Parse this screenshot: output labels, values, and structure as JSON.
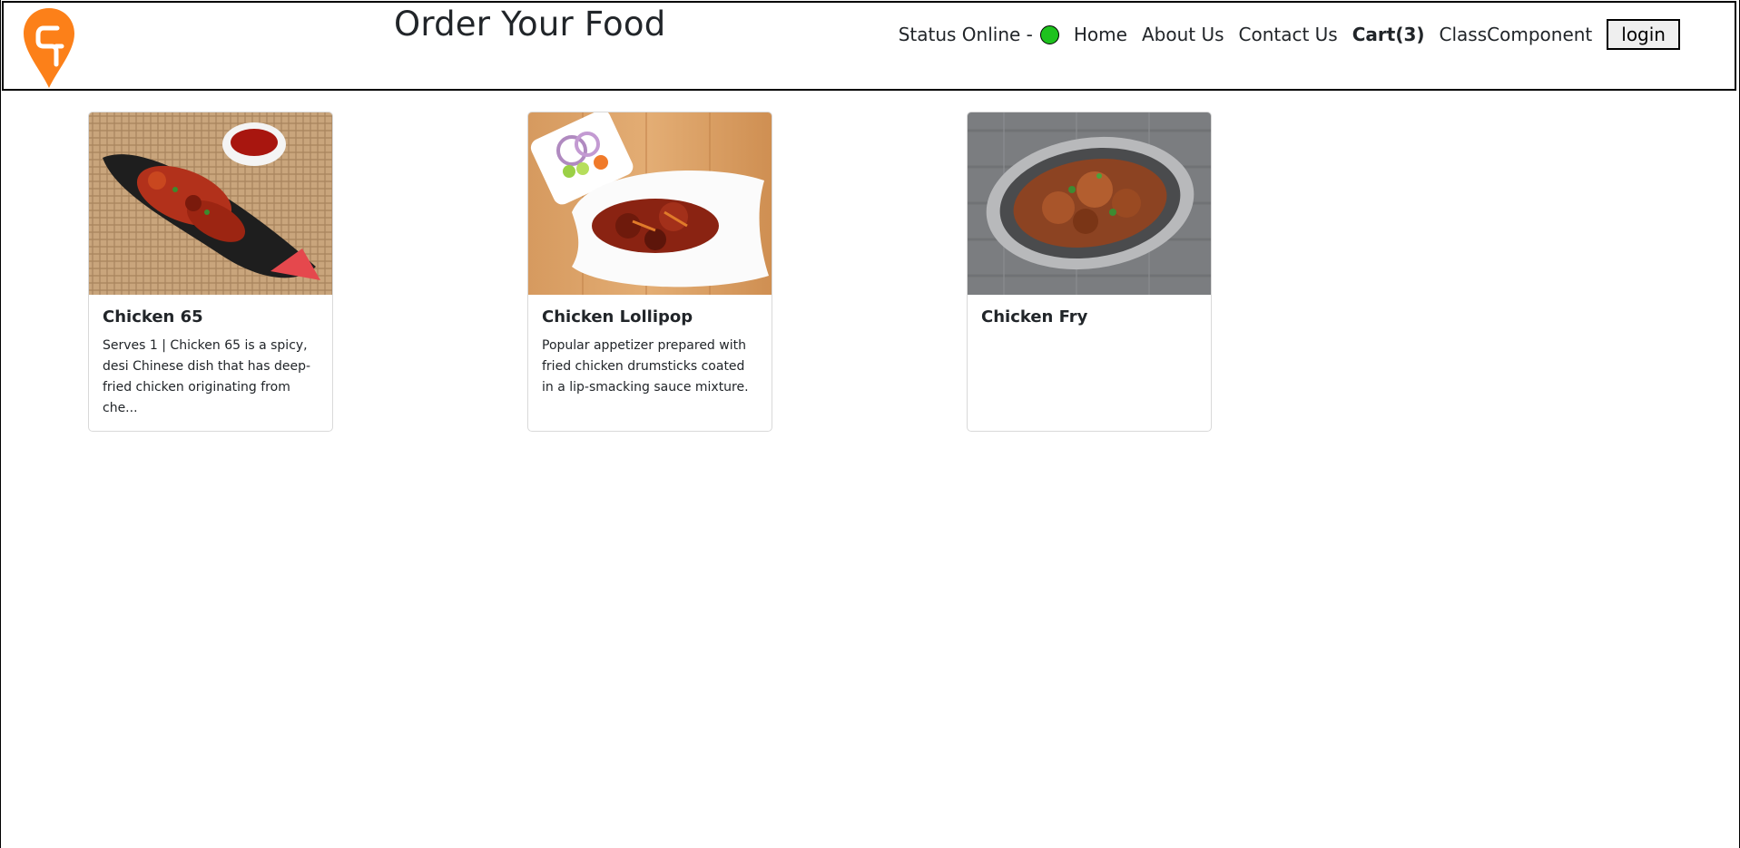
{
  "header": {
    "title": "Order Your Food",
    "logo_icon": "swiggy-logo-icon",
    "brand_color": "#fc8019"
  },
  "nav": {
    "status_label": "Status Online -",
    "status_color": "#1ec21e",
    "items": [
      {
        "label": "Home"
      },
      {
        "label": "About Us"
      },
      {
        "label": "Contact Us"
      },
      {
        "label": "Cart(3)"
      },
      {
        "label": "ClassComponent"
      }
    ],
    "login_label": "login"
  },
  "cards": [
    {
      "title": "Chicken 65",
      "description": "Serves 1 | Chicken 65 is a spicy, desi Chinese dish that has deep-fried chicken originating from che..."
    },
    {
      "title": "Chicken Lollipop",
      "description": "Popular appetizer prepared with fried chicken drumsticks coated in a lip-smacking sauce mixture."
    },
    {
      "title": "Chicken Fry",
      "description": ""
    }
  ]
}
